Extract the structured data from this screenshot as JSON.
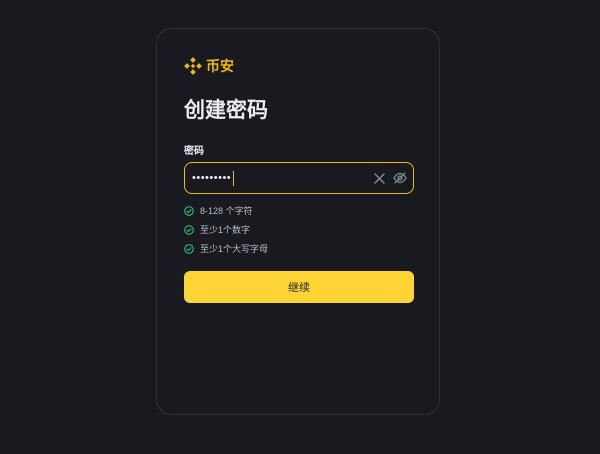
{
  "brand": {
    "name": "币安",
    "logo_icon": "binance-logo-icon",
    "accent_color": "#f0b90b"
  },
  "page": {
    "title": "创建密码"
  },
  "password_field": {
    "label": "密码",
    "masked_value": "•••••••••",
    "clear_icon": "close-icon",
    "visibility_icon": "eye-off-icon",
    "border_color": "#f0b90b"
  },
  "requirements": [
    {
      "text": "8-128 个字符",
      "icon": "check-circle-icon",
      "met": true
    },
    {
      "text": "至少1个数字",
      "icon": "check-circle-icon",
      "met": true
    },
    {
      "text": "至少1个大写字母",
      "icon": "check-circle-icon",
      "met": true
    }
  ],
  "continue_button": {
    "label": "继续",
    "color": "#fcd535"
  }
}
